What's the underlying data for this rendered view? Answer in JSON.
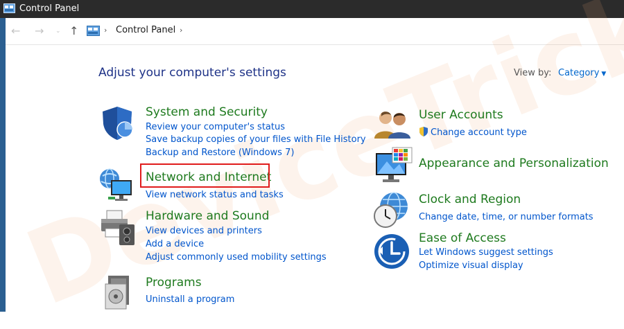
{
  "window": {
    "title": "Control Panel"
  },
  "address": {
    "crumb": "Control Panel"
  },
  "main": {
    "heading": "Adjust your computer's settings",
    "view_by_label": "View by:",
    "view_by_value": "Category"
  },
  "categories": [
    {
      "title": "System and Security",
      "icon": "shield-icon",
      "links": [
        "Review your computer's status",
        "Save backup copies of your files with File History",
        "Backup and Restore (Windows 7)"
      ]
    },
    {
      "title": "Network and Internet",
      "icon": "network-icon",
      "links": [
        "View network status and tasks"
      ]
    },
    {
      "title": "Hardware and Sound",
      "icon": "printer-icon",
      "links": [
        "View devices and printers",
        "Add a device",
        "Adjust commonly used mobility settings"
      ]
    },
    {
      "title": "Programs",
      "icon": "programs-icon",
      "links": [
        "Uninstall a program"
      ]
    },
    {
      "title": "User Accounts",
      "icon": "users-icon",
      "links": [
        "Change account type"
      ]
    },
    {
      "title": "Appearance and Personalization",
      "icon": "monitor-icon",
      "links": []
    },
    {
      "title": "Clock and Region",
      "icon": "clock-globe-icon",
      "links": [
        "Change date, time, or number formats"
      ]
    },
    {
      "title": "Ease of Access",
      "icon": "ease-of-access-icon",
      "links": [
        "Let Windows suggest settings",
        "Optimize visual display"
      ]
    }
  ],
  "watermark": "DeviceTricks",
  "colors": {
    "link": "#0055cc",
    "category_title": "#1e7a1e",
    "heading": "#1e3287",
    "highlight": "#e01b1b"
  }
}
